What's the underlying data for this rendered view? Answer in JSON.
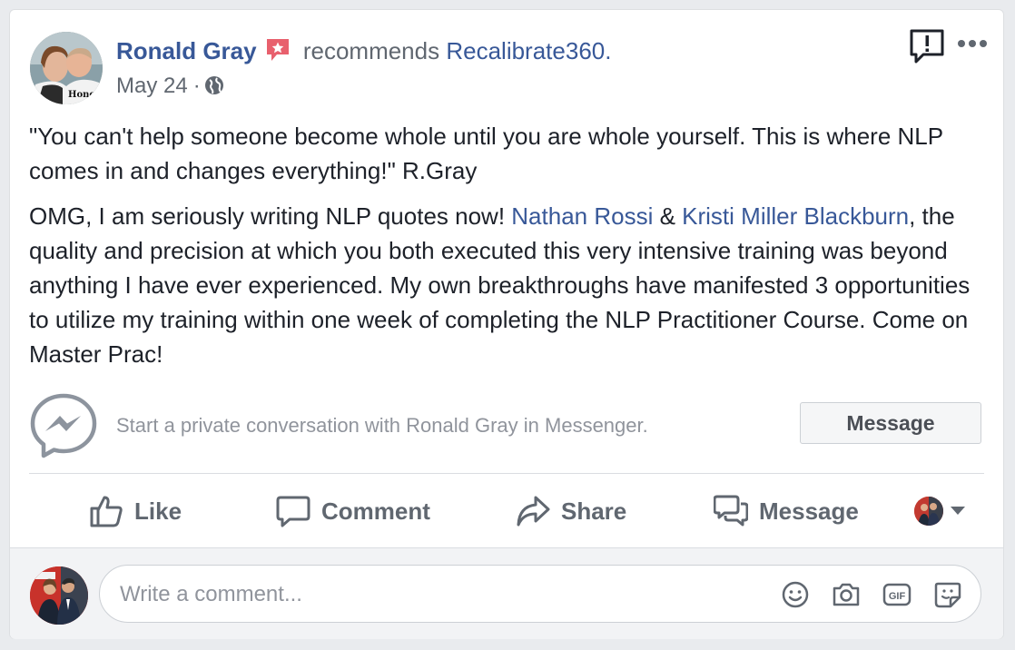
{
  "post": {
    "author": "Ronald Gray",
    "verb": "recommends",
    "page_name": "Recalibrate360.",
    "date": "May 24",
    "separator": "·",
    "avatar_shirt_text": "Honor · H",
    "quote": "\"You can't help someone become whole until you are whole yourself. This is where NLP comes in and changes everything!\" R.Gray",
    "body_intro": "OMG, I am seriously writing NLP quotes now! ",
    "mention_1": "Nathan Rossi",
    "amp": " & ",
    "mention_2": "Kristi Miller Blackburn",
    "body_rest": ", the quality and precision at which you both executed this very intensive training was beyond anything I have ever experienced. My own breakthroughs have manifested 3 opportunities to utilize my training within one week of completing the NLP Practitioner Course. Come on Master Prac!"
  },
  "messenger": {
    "prompt": "Start a private conversation with Ronald Gray in Messenger.",
    "button_label": "Message"
  },
  "actions": {
    "like": "Like",
    "comment": "Comment",
    "share": "Share",
    "message": "Message"
  },
  "comment": {
    "placeholder": "Write a comment..."
  },
  "icons": {
    "badge": "recommendation-star-icon",
    "globe": "globe-icon",
    "report": "report-icon",
    "more": "more-options-icon",
    "messenger": "messenger-icon",
    "like": "thumbs-up-icon",
    "comment": "comment-bubble-icon",
    "share": "share-arrow-icon",
    "message": "message-bubbles-icon",
    "emoji": "emoji-icon",
    "camera": "camera-icon",
    "gif": "gif-icon",
    "sticker": "sticker-icon"
  },
  "colors": {
    "link": "#385898",
    "secondary_text": "#606770",
    "body_text": "#1d2129",
    "badge": "#e8606d"
  }
}
